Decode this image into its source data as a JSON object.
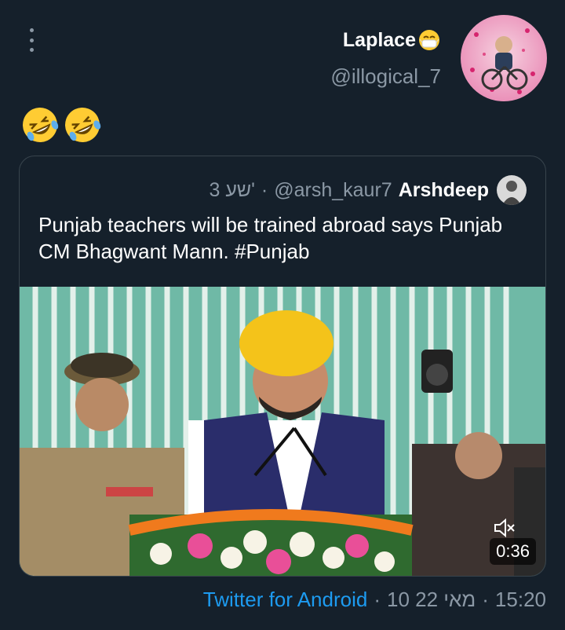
{
  "tweet": {
    "author_name": "Laplace",
    "author_handle": "@illogical_7",
    "name_emoji": "mask-face-emoji",
    "body_emojis": [
      "rofl-emoji",
      "rofl-emoji"
    ],
    "time": "15:20",
    "date": "10 מאי 22",
    "source": "Twitter for Android"
  },
  "quoted": {
    "author_name": "Arshdeep",
    "author_handle": "@arsh_kaur7",
    "time_ago": "3 שע'",
    "text": "Punjab teachers will be trained abroad says Punjab CM Bhagwant Mann. #Punjab",
    "video_duration": "0:36"
  },
  "colors": {
    "background": "#15202b",
    "secondary_text": "#8b98a5",
    "link": "#1d9bf0",
    "border": "#38444d"
  }
}
